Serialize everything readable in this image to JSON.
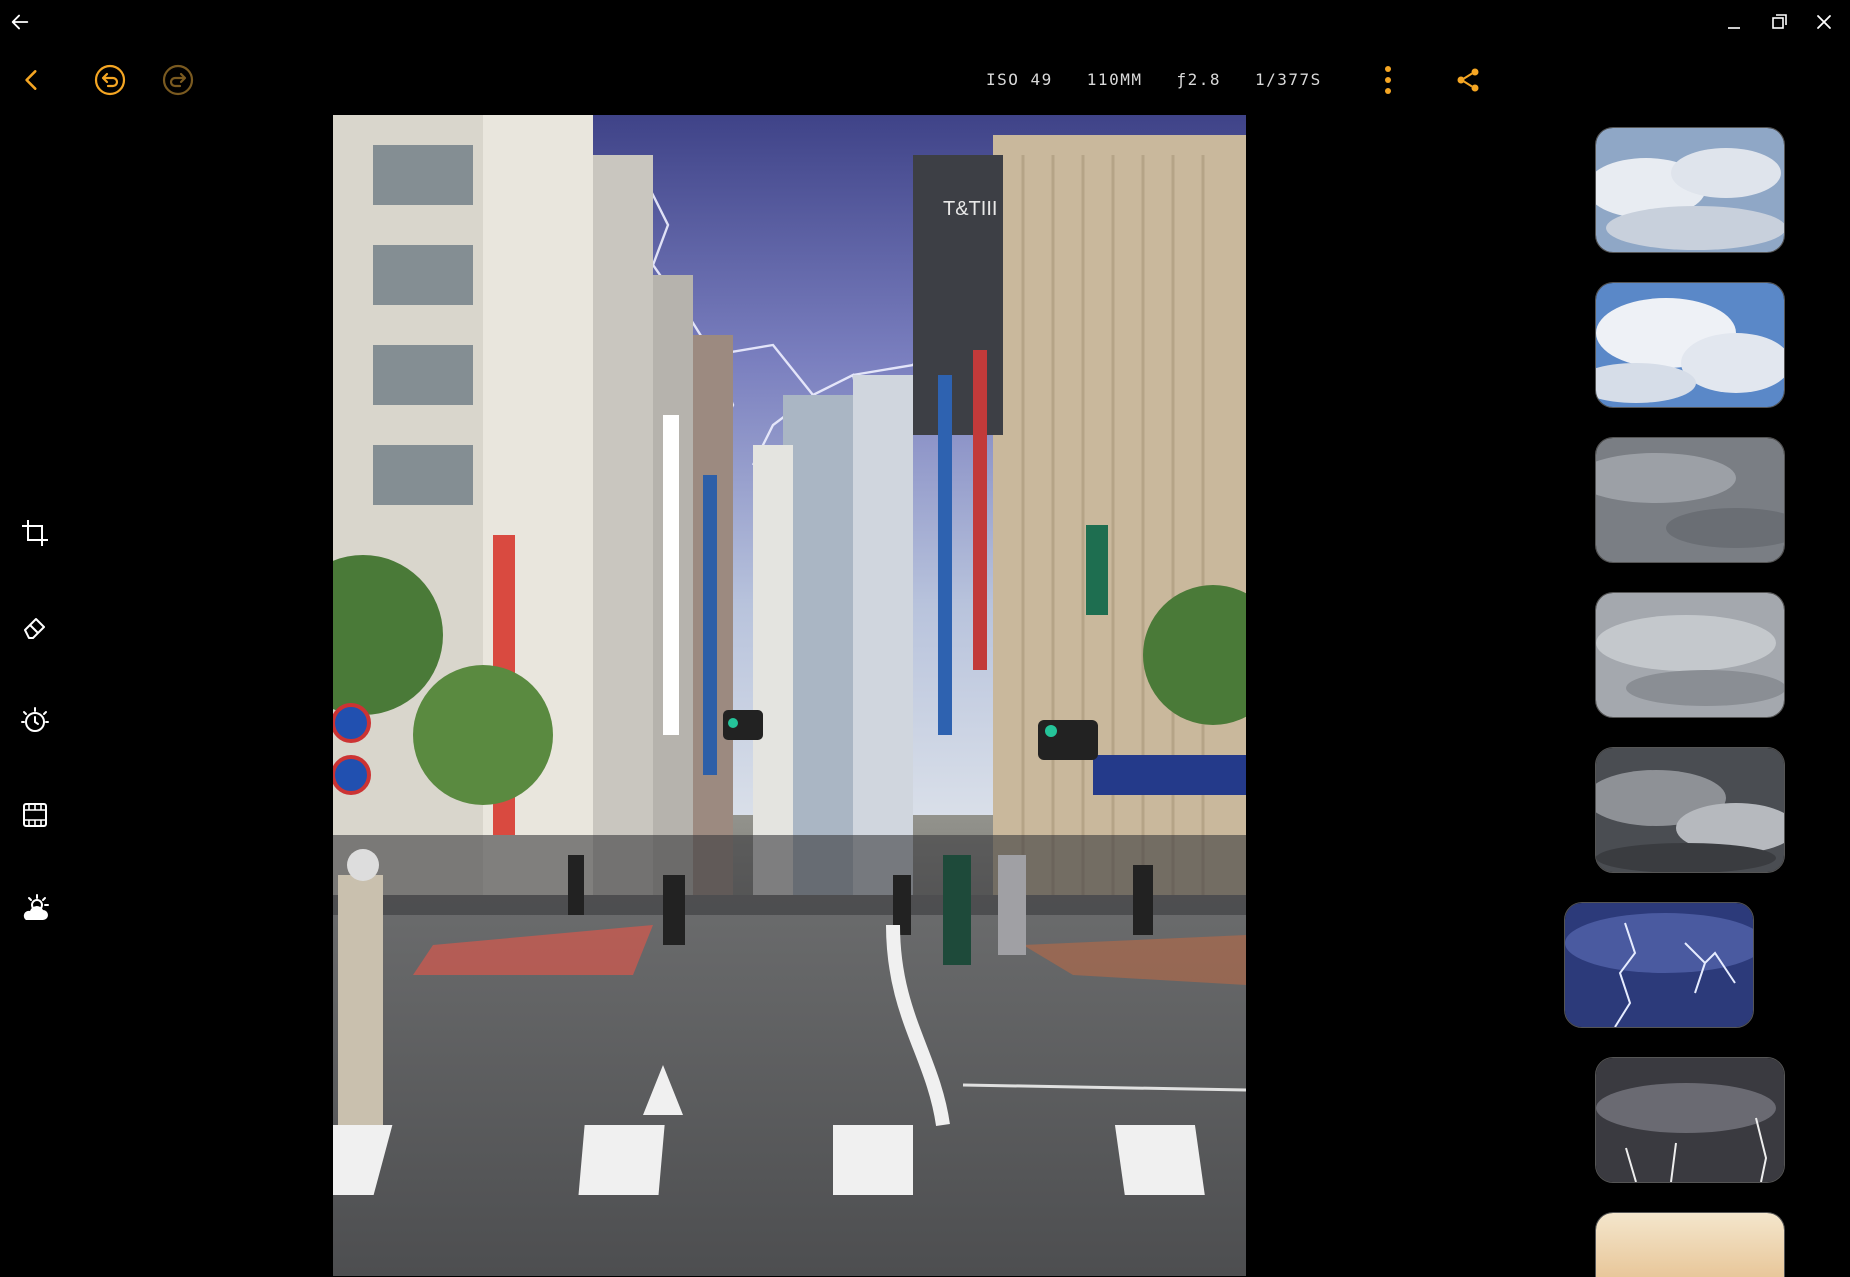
{
  "window": {
    "back_icon": "arrow-left-icon",
    "minimize_icon": "minimize-icon",
    "maximize_icon": "restore-icon",
    "close_icon": "close-icon"
  },
  "toolbar": {
    "exif": {
      "iso": "ISO 49",
      "focal": "110MM",
      "aperture": "ƒ2.8",
      "shutter": "1/377S"
    },
    "accent_color": "#f5a623"
  },
  "tools": [
    {
      "name": "crop-icon"
    },
    {
      "name": "eraser-icon"
    },
    {
      "name": "exposure-icon"
    },
    {
      "name": "film-icon"
    },
    {
      "name": "weather-icon"
    }
  ],
  "sky_presets": [
    {
      "name": "fair-clouds",
      "selected": false
    },
    {
      "name": "cumulus-clouds",
      "selected": false
    },
    {
      "name": "overcast-gray",
      "selected": false
    },
    {
      "name": "overcast-light",
      "selected": false
    },
    {
      "name": "storm-clouds",
      "selected": false
    },
    {
      "name": "lightning-blue",
      "selected": true
    },
    {
      "name": "lightning-dark",
      "selected": false
    },
    {
      "name": "sunset",
      "selected": false
    }
  ]
}
